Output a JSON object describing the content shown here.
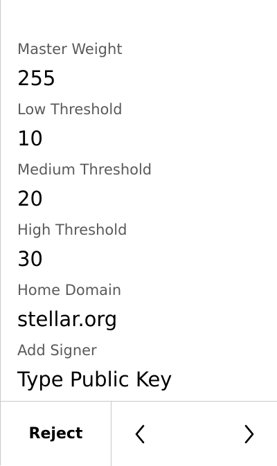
{
  "fields": [
    {
      "label": "Master Weight",
      "value": "255"
    },
    {
      "label": "Low Threshold",
      "value": "10"
    },
    {
      "label": "Medium Threshold",
      "value": "20"
    },
    {
      "label": "High Threshold",
      "value": "30"
    },
    {
      "label": "Home Domain",
      "value": "stellar.org"
    },
    {
      "label": "Add Signer",
      "value": "Type Public Key"
    }
  ],
  "footer": {
    "reject_label": "Reject",
    "prev_icon": "chevron-left-icon",
    "next_icon": "chevron-right-icon"
  },
  "colors": {
    "label": "#5a5a5a",
    "value": "#000000",
    "divider": "#c8c8c8",
    "background": "#ffffff"
  }
}
